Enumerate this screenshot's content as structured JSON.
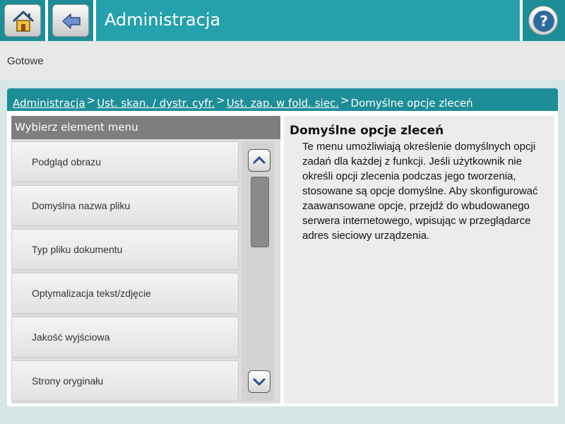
{
  "header": {
    "title": "Administracja",
    "home_icon": "home-icon",
    "back_icon": "back-arrow-icon",
    "help_icon": "help-icon"
  },
  "status": {
    "text": "Gotowe"
  },
  "breadcrumb": [
    {
      "label": "Administracja",
      "link": true
    },
    {
      "label": "Ust. skan. / dystr. cyfr.",
      "link": true
    },
    {
      "label": "Ust. zap. w fold. siec.",
      "link": true
    },
    {
      "label": "Domyślne opcje zleceń",
      "link": false
    }
  ],
  "breadcrumb_separator": ">",
  "menu": {
    "header": "Wybierz element menu",
    "items": [
      {
        "label": "Podgląd obrazu"
      },
      {
        "label": "Domyślna nazwa pliku"
      },
      {
        "label": "Typ pliku dokumentu"
      },
      {
        "label": "Optymalizacja tekst/zdjęcie"
      },
      {
        "label": "Jakość wyjściowa"
      },
      {
        "label": "Strony oryginału"
      }
    ],
    "scroll_up_icon": "chevron-up-icon",
    "scroll_down_icon": "chevron-down-icon"
  },
  "help": {
    "title": "Domyślne opcje zleceń",
    "body": "Te menu umożliwiają określenie domyślnych opcji zadań dla każdej z funkcji. Jeśli użytkownik nie określi opcji zlecenia podczas jego tworzenia, stosowane są opcje domyślne. Aby skonfigurować zaawansowane opcje, przejdź do wbudowanego serwera internetowego, wpisując w przeglądarce adres sieciowy urządzenia."
  },
  "colors": {
    "accent": "#25a1ad",
    "accent_dark": "#1d8d97",
    "menu_header": "#7e7e7e"
  }
}
